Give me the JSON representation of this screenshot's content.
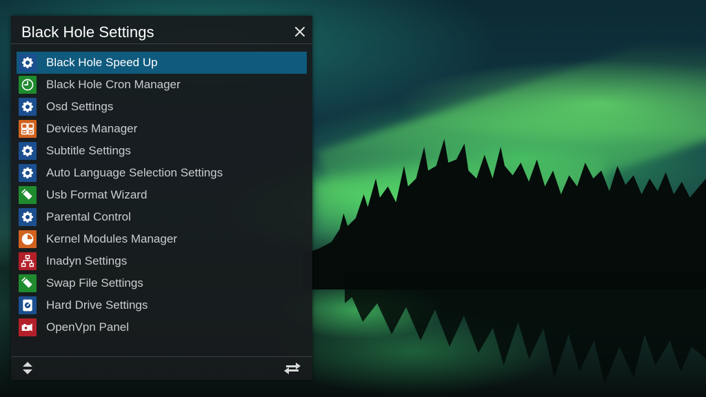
{
  "window": {
    "title": "Black Hole Settings"
  },
  "colors": {
    "selected_bg": "#0f5a7d",
    "blue": "#1c4f8f",
    "green": "#1f8a2e",
    "orange": "#d2631f",
    "red": "#b3202a"
  },
  "menu": {
    "items": [
      {
        "label": "Black Hole Speed Up",
        "icon": "gear-icon",
        "color": "blue",
        "selected": true
      },
      {
        "label": "Black Hole Cron Manager",
        "icon": "clock-icon",
        "color": "green"
      },
      {
        "label": "Osd Settings",
        "icon": "gear-icon",
        "color": "blue"
      },
      {
        "label": "Devices Manager",
        "icon": "devices-grid-icon",
        "color": "orange"
      },
      {
        "label": "Subtitle Settings",
        "icon": "gear-icon",
        "color": "blue"
      },
      {
        "label": "Auto Language Selection Settings",
        "icon": "gear-icon",
        "color": "blue"
      },
      {
        "label": "Usb Format Wizard",
        "icon": "usb-stick-icon",
        "color": "green"
      },
      {
        "label": "Parental Control",
        "icon": "gear-icon",
        "color": "blue"
      },
      {
        "label": "Kernel Modules Manager",
        "icon": "pie-chart-icon",
        "color": "orange"
      },
      {
        "label": "Inadyn Settings",
        "icon": "network-icon",
        "color": "red"
      },
      {
        "label": "Swap File Settings",
        "icon": "usb-stick-icon",
        "color": "green"
      },
      {
        "label": "Hard Drive Settings",
        "icon": "hard-drive-icon",
        "color": "blue"
      },
      {
        "label": "OpenVpn Panel",
        "icon": "camera-icon",
        "color": "red"
      }
    ]
  },
  "footer": {
    "left_icon": "up-down-arrows-icon",
    "right_icon": "swap-arrows-icon"
  }
}
